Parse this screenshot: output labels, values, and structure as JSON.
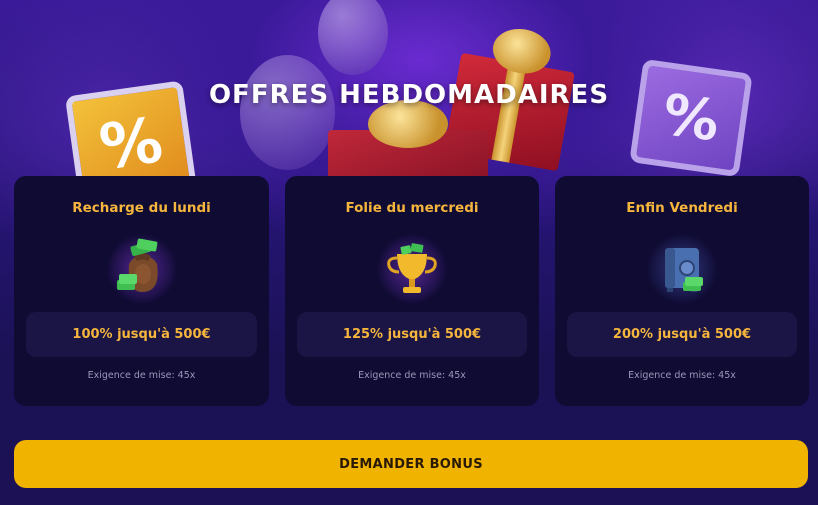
{
  "header": {
    "title": "OFFRES HEBDOMADAIRES"
  },
  "offers": [
    {
      "day_title": "Recharge du lundi",
      "bonus": "100% jusqu'à 500€",
      "wagering": "Exigence de mise: 45x",
      "icon": "money-bag-icon"
    },
    {
      "day_title": "Folie du mercredi",
      "bonus": "125% jusqu'à 500€",
      "wagering": "Exigence de mise: 45x",
      "icon": "trophy-icon"
    },
    {
      "day_title": "Enfin Vendredi",
      "bonus": "200% jusqu'à 500€",
      "wagering": "Exigence de mise: 45x",
      "icon": "safe-icon"
    }
  ],
  "cta": {
    "label": "DEMANDER BONUS"
  },
  "decor": {
    "percent_symbol": "%"
  },
  "colors": {
    "accent": "#f6b53c",
    "button": "#f0b400",
    "card_bg": "#0f0b33",
    "page_bg": "#1b1256"
  }
}
